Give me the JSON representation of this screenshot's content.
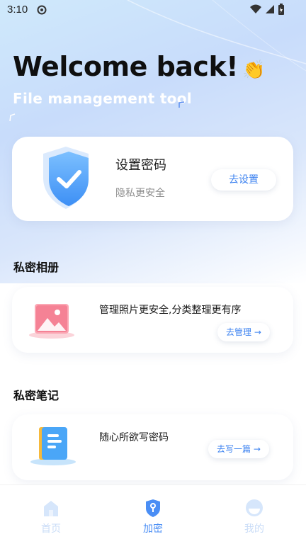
{
  "status_bar": {
    "time": "3:10",
    "icons": [
      "gear-icon",
      "wifi-icon",
      "signal-icon",
      "battery-icon"
    ]
  },
  "header": {
    "title": "Welcome back!",
    "title_emoji": "👏",
    "subtitle": "File management tool"
  },
  "password_card": {
    "title": "设置密码",
    "subtitle": "隐私更安全",
    "button": "去设置",
    "icon": "shield-check-icon"
  },
  "album_section": {
    "title": "私密相册",
    "description": "管理照片更安全,分类整理更有序",
    "button": "去管理 →",
    "icon": "photo-icon"
  },
  "notes_section": {
    "title": "私密笔记",
    "description": "随心所欲写密码",
    "button": "去写一篇 →",
    "icon": "notebook-icon"
  },
  "tabbar": {
    "active": "加密",
    "tabs": [
      {
        "label": "首页",
        "icon": "home-icon"
      },
      {
        "label": "加密",
        "icon": "lock-shield-icon"
      },
      {
        "label": "我的",
        "icon": "profile-icon"
      }
    ]
  },
  "colors": {
    "accent": "#4a8ef5",
    "inactive": "#c9dcf7",
    "text": "#1b1b1b",
    "muted": "#8c8c8c"
  }
}
